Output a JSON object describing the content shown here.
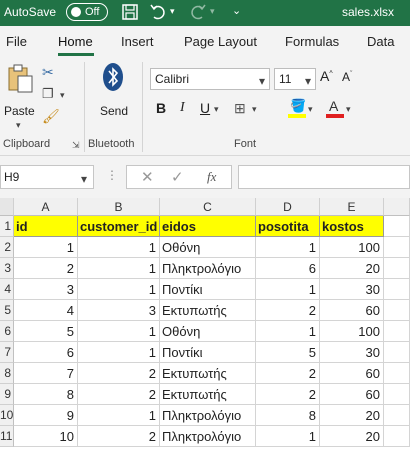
{
  "titlebar": {
    "autosave_label": "AutoSave",
    "toggle_state": "Off",
    "filename": "sales.xlsx"
  },
  "menu_tabs": [
    "File",
    "Home",
    "Insert",
    "Page Layout",
    "Formulas",
    "Data"
  ],
  "active_tab": "Home",
  "ribbon": {
    "clipboard": {
      "paste_label": "Paste",
      "group_label": "Clipboard"
    },
    "bluetooth": {
      "send_label": "Send",
      "group_label": "Bluetooth"
    },
    "font": {
      "font_name": "Calibri",
      "font_size": "11",
      "group_label": "Font",
      "bold": "B",
      "italic": "I",
      "underline": "U"
    }
  },
  "formula_bar": {
    "name_box": "H9",
    "fx_label": "fx",
    "formula": ""
  },
  "grid": {
    "columns": [
      "A",
      "B",
      "C",
      "D",
      "E"
    ],
    "row_numbers": [
      "1",
      "2",
      "3",
      "4",
      "5",
      "6",
      "7",
      "8",
      "9",
      "10",
      "11"
    ],
    "header_row": [
      "id",
      "customer_id",
      "eidos",
      "posotita",
      "kostos"
    ],
    "rows": [
      [
        "1",
        "1",
        "Οθόνη",
        "1",
        "100"
      ],
      [
        "2",
        "1",
        "Πληκτρολόγιο",
        "6",
        "20"
      ],
      [
        "3",
        "1",
        "Ποντίκι",
        "1",
        "30"
      ],
      [
        "4",
        "3",
        "Εκτυπωτής",
        "2",
        "60"
      ],
      [
        "5",
        "1",
        "Οθόνη",
        "1",
        "100"
      ],
      [
        "6",
        "1",
        "Ποντίκι",
        "5",
        "30"
      ],
      [
        "7",
        "2",
        "Εκτυπωτής",
        "2",
        "60"
      ],
      [
        "8",
        "2",
        "Εκτυπωτής",
        "2",
        "60"
      ],
      [
        "9",
        "1",
        "Πληκτρολόγιο",
        "8",
        "20"
      ],
      [
        "10",
        "2",
        "Πληκτρολόγιο",
        "1",
        "20"
      ]
    ]
  },
  "colors": {
    "excel_green": "#217346",
    "header_fill": "#ffff00"
  }
}
